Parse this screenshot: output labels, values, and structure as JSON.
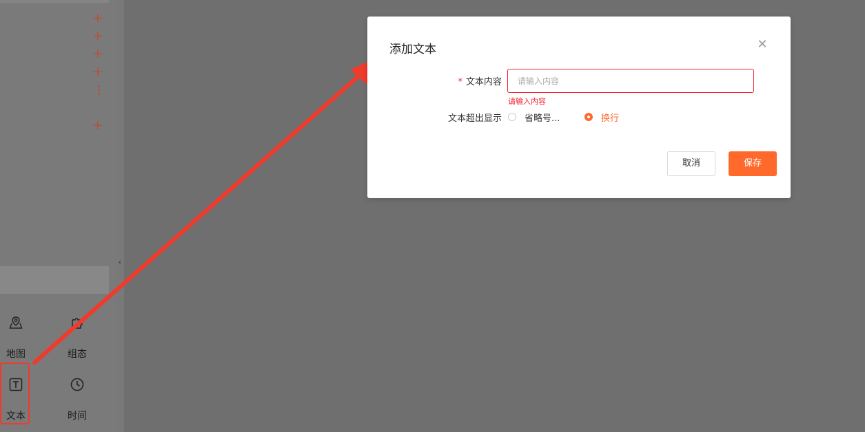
{
  "left_panel": {
    "components": [
      {
        "label": "地图",
        "icon": "map-icon"
      },
      {
        "label": "组态",
        "icon": "puzzle-icon"
      },
      {
        "label": "文本",
        "icon": "text-icon"
      },
      {
        "label": "时间",
        "icon": "clock-icon"
      }
    ]
  },
  "modal": {
    "title": "添加文本",
    "close_icon": "close-icon",
    "content_field": {
      "label": "文本内容",
      "required_mark": "*",
      "placeholder": "请输入内容",
      "value": "",
      "error": "请输入内容"
    },
    "overflow_field": {
      "label": "文本超出显示",
      "options": [
        {
          "label": "省略号...",
          "checked": false
        },
        {
          "label": "换行",
          "checked": true
        }
      ]
    },
    "buttons": {
      "cancel": "取消",
      "save": "保存"
    }
  },
  "colors": {
    "accent": "#ff6a2c",
    "error": "#f5222d",
    "annotation": "#f03a2c",
    "overlay": "#6f6f6f"
  }
}
